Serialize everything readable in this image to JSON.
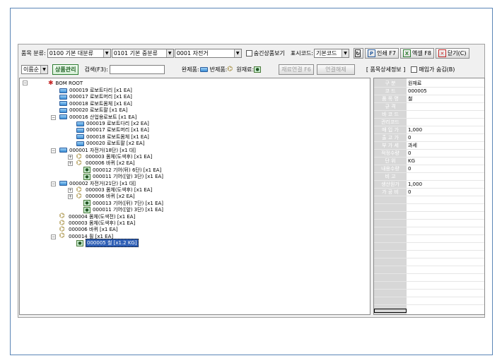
{
  "toolbar": {
    "category_label": "품목 분류:",
    "category1": "0100 기본 대분류",
    "category2": "0101 기본 중분류",
    "item_combo": "0001 자전거",
    "hide_intermediate": "숨긴상품보기",
    "display_code_label": "표시코드:",
    "display_code_value": "기본코드",
    "print_label": "인쇄 F7",
    "excel_label": "엑셀 F8",
    "close_label": "닫기(C)"
  },
  "toolbar2": {
    "sort_value": "이름순",
    "product_mgmt": "상품관리",
    "search_label": "검색(F3):",
    "search_value": "",
    "legend_finished": "완제품:",
    "legend_semi": "반제품:",
    "legend_raw": "원재료:",
    "material_link": "재료연결 F6",
    "unlink": "연결해제",
    "detail_info": "[ 품목상세정보 ]",
    "hide_purchase_price": "매입가 숨김(B)"
  },
  "tree": {
    "root": "BOM ROOT",
    "nodes": [
      {
        "type": "folder",
        "text": "000019 로보트다리 [x1 EA]"
      },
      {
        "type": "folder",
        "text": "000017 로보트머리 [x1 EA]"
      },
      {
        "type": "folder",
        "text": "000018 로보트몸체 [x1 EA]"
      },
      {
        "type": "folder",
        "text": "000020 로보트팔 [x1 EA]"
      },
      {
        "type": "folder",
        "text": "000016 산업용로보트 [x1 EA]"
      },
      {
        "type": "folder",
        "text": "000019 로보트다리 [x2 EA]"
      },
      {
        "type": "folder",
        "text": "000017 로보트머리 [x1 EA]"
      },
      {
        "type": "folder",
        "text": "000018 로보트몸체 [x1 EA]"
      },
      {
        "type": "folder",
        "text": "000020 로보트팔 [x2 EA]"
      },
      {
        "type": "folder",
        "text": "000001 자전거(18단) [x1 대]"
      },
      {
        "type": "assy",
        "text": "000003 몸체(도색후) [x1 EA]"
      },
      {
        "type": "assy",
        "text": "000006 바퀴 [x2 EA]"
      },
      {
        "type": "part",
        "text": "000012 기어(뒤) 6단) [x1 EA]"
      },
      {
        "type": "part",
        "text": "000011 기어([앞) 3단) [x1 EA]"
      },
      {
        "type": "folder",
        "text": "000002 자전거(21단) [x1 대]"
      },
      {
        "type": "assy",
        "text": "000003 몸체(도색후) [x1 EA]"
      },
      {
        "type": "assy",
        "text": "000006 바퀴 [x2 EA]"
      },
      {
        "type": "part",
        "text": "000013 기어([뒤) 7단) [x1 EA]"
      },
      {
        "type": "part",
        "text": "000011 기어([앞) 3단) [x1 EA]"
      },
      {
        "type": "assy",
        "text": "000004 몸체(도색전) [x1 EA]"
      },
      {
        "type": "assy",
        "text": "000003 몸체(도색후) [x1 EA]"
      },
      {
        "type": "assy",
        "text": "000006 바퀴 [x1 EA]"
      },
      {
        "type": "assy",
        "text": "000014 휠 [x1 EA]"
      },
      {
        "type": "part",
        "text": "000005 철 [x1.2 KG]"
      }
    ]
  },
  "props": [
    {
      "key": "구 분",
      "value": "원재료"
    },
    {
      "key": "코 드",
      "value": "000005"
    },
    {
      "key": "품 목 명",
      "value": "철"
    },
    {
      "key": "규 격",
      "value": ""
    },
    {
      "key": "바 코 드",
      "value": ""
    },
    {
      "key": "관리코드",
      "value": ""
    },
    {
      "key": "매 입 가",
      "value": "1,000"
    },
    {
      "key": "출 고 가",
      "value": "0"
    },
    {
      "key": "부 가 세",
      "value": "과세"
    },
    {
      "key": "적정수량",
      "value": "0"
    },
    {
      "key": "단 위",
      "value": "KG"
    },
    {
      "key": "내용수량",
      "value": "0"
    },
    {
      "key": "비 고",
      "value": ""
    },
    {
      "key": "생산원가",
      "value": "1,000"
    },
    {
      "key": "가 공 비",
      "value": "0"
    }
  ],
  "colors": {
    "frame": "#5b86b6",
    "selected": "#2f5fb5",
    "green": "#2e7d32"
  }
}
